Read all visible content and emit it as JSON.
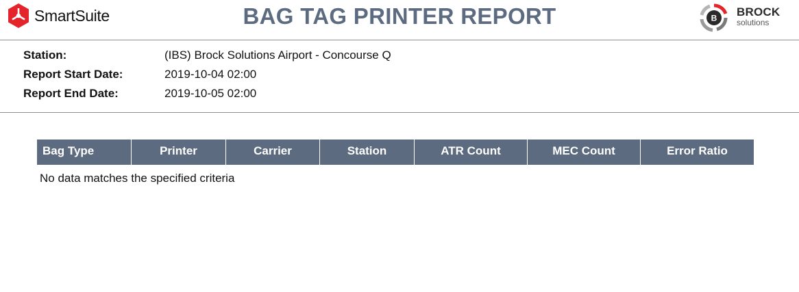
{
  "header": {
    "left_brand": "SmartSuite",
    "title": "BAG TAG PRINTER REPORT",
    "right_brand_top": "BROCK",
    "right_brand_bottom": "solutions",
    "right_brand_badge": "B"
  },
  "meta": [
    {
      "label": "Station:",
      "value": "(IBS) Brock Solutions Airport - Concourse Q"
    },
    {
      "label": "Report Start Date:",
      "value": "2019-10-04 02:00"
    },
    {
      "label": "Report End Date:",
      "value": "2019-10-05 02:00"
    }
  ],
  "table": {
    "columns": [
      "Bag Type",
      "Printer",
      "Carrier",
      "Station",
      "ATR Count",
      "MEC Count",
      "Error Ratio"
    ],
    "rows": [],
    "empty_message": "No data matches the specified criteria"
  },
  "colors": {
    "accent": "#5d6b80",
    "logo_red": "#e3242b",
    "rule": "#8c8c8c"
  }
}
